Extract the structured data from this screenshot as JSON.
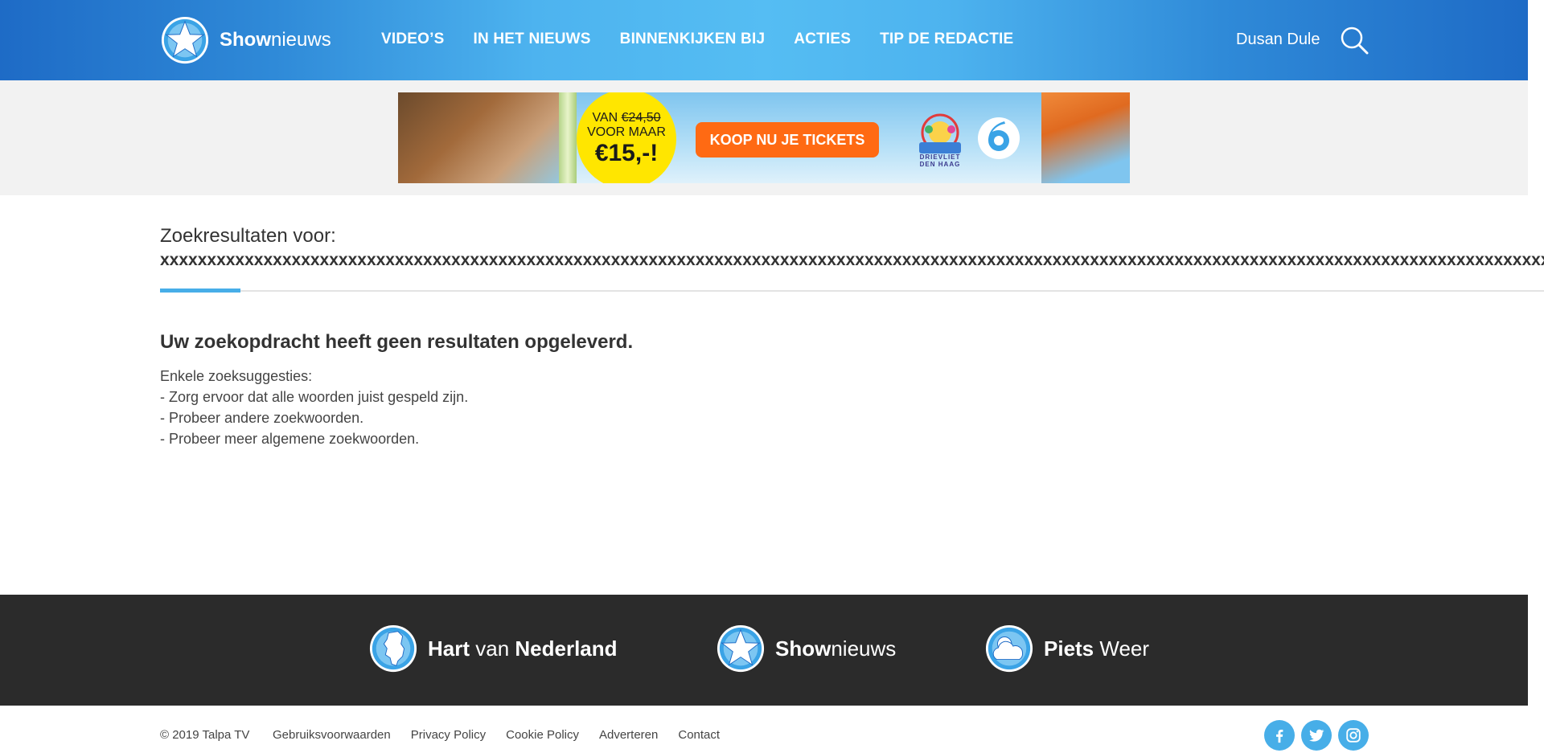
{
  "header": {
    "logo": {
      "bold": "Show",
      "light": "nieuws",
      "icon": "star-icon"
    },
    "nav": [
      "VIDEO’S",
      "IN HET NIEUWS",
      "BINNENKIJKEN BIJ",
      "ACTIES",
      "TIP DE REDACTIE"
    ],
    "user_name": "Dusan Dule",
    "search_icon": "search-icon"
  },
  "ad": {
    "badge_van": "VAN",
    "badge_old_price": "€24,50",
    "badge_voor_maar": "VOOR MAAR",
    "badge_new_price": "€15,-!",
    "cta": "KOOP NU JE TICKETS",
    "park_name": "DRIEVLIET",
    "park_sub": "DEN HAAG",
    "channel_logo": "sbs6-logo"
  },
  "search": {
    "title": "Zoekresultaten voor:",
    "query": "xxxxxxxxxxxxxxxxxxxxxxxxxxxxxxxxxxxxxxxxxxxxxxxxxxxxxxxxxxxxxxxxxxxxxxxxxxxxxxxxxxxxxxxxxxxxxxxxxxxxxxxxxxxxxxxxxxxxxxxxxxxxxxxxxxxxxxxxxxxxxxxxxxxxxxxxxxxx",
    "no_results": "Uw zoekopdracht heeft geen resultaten opgeleverd.",
    "suggestions_heading": "Enkele zoeksuggesties:",
    "suggestions": [
      "- Zorg ervoor dat alle woorden juist gespeld zijn.",
      "- Probeer andere zoekwoorden.",
      "- Probeer meer algemene zoekwoorden."
    ]
  },
  "footer": {
    "brands": [
      {
        "bold1": "Hart",
        "light": " van ",
        "bold2": "Nederland",
        "icon": "netherlands-map-icon"
      },
      {
        "bold1": "Show",
        "light": "nieuws",
        "bold2": "",
        "icon": "star-icon"
      },
      {
        "bold1": "Piets",
        "light": " Weer",
        "bold2": "",
        "icon": "weather-cloud-icon"
      }
    ],
    "copyright": "© 2019 Talpa TV",
    "links": [
      "Gebruiksvoorwaarden",
      "Privacy Policy",
      "Cookie Policy",
      "Adverteren",
      "Contact"
    ],
    "social": [
      "facebook-icon",
      "twitter-icon",
      "instagram-icon"
    ]
  },
  "colors": {
    "header_blue": "#1e6bc6",
    "header_light_blue": "#55bdf3",
    "accent": "#47aee8",
    "footer_dark": "#2b2b2b",
    "cta_orange": "#ff6a13",
    "badge_yellow": "#ffe600"
  }
}
